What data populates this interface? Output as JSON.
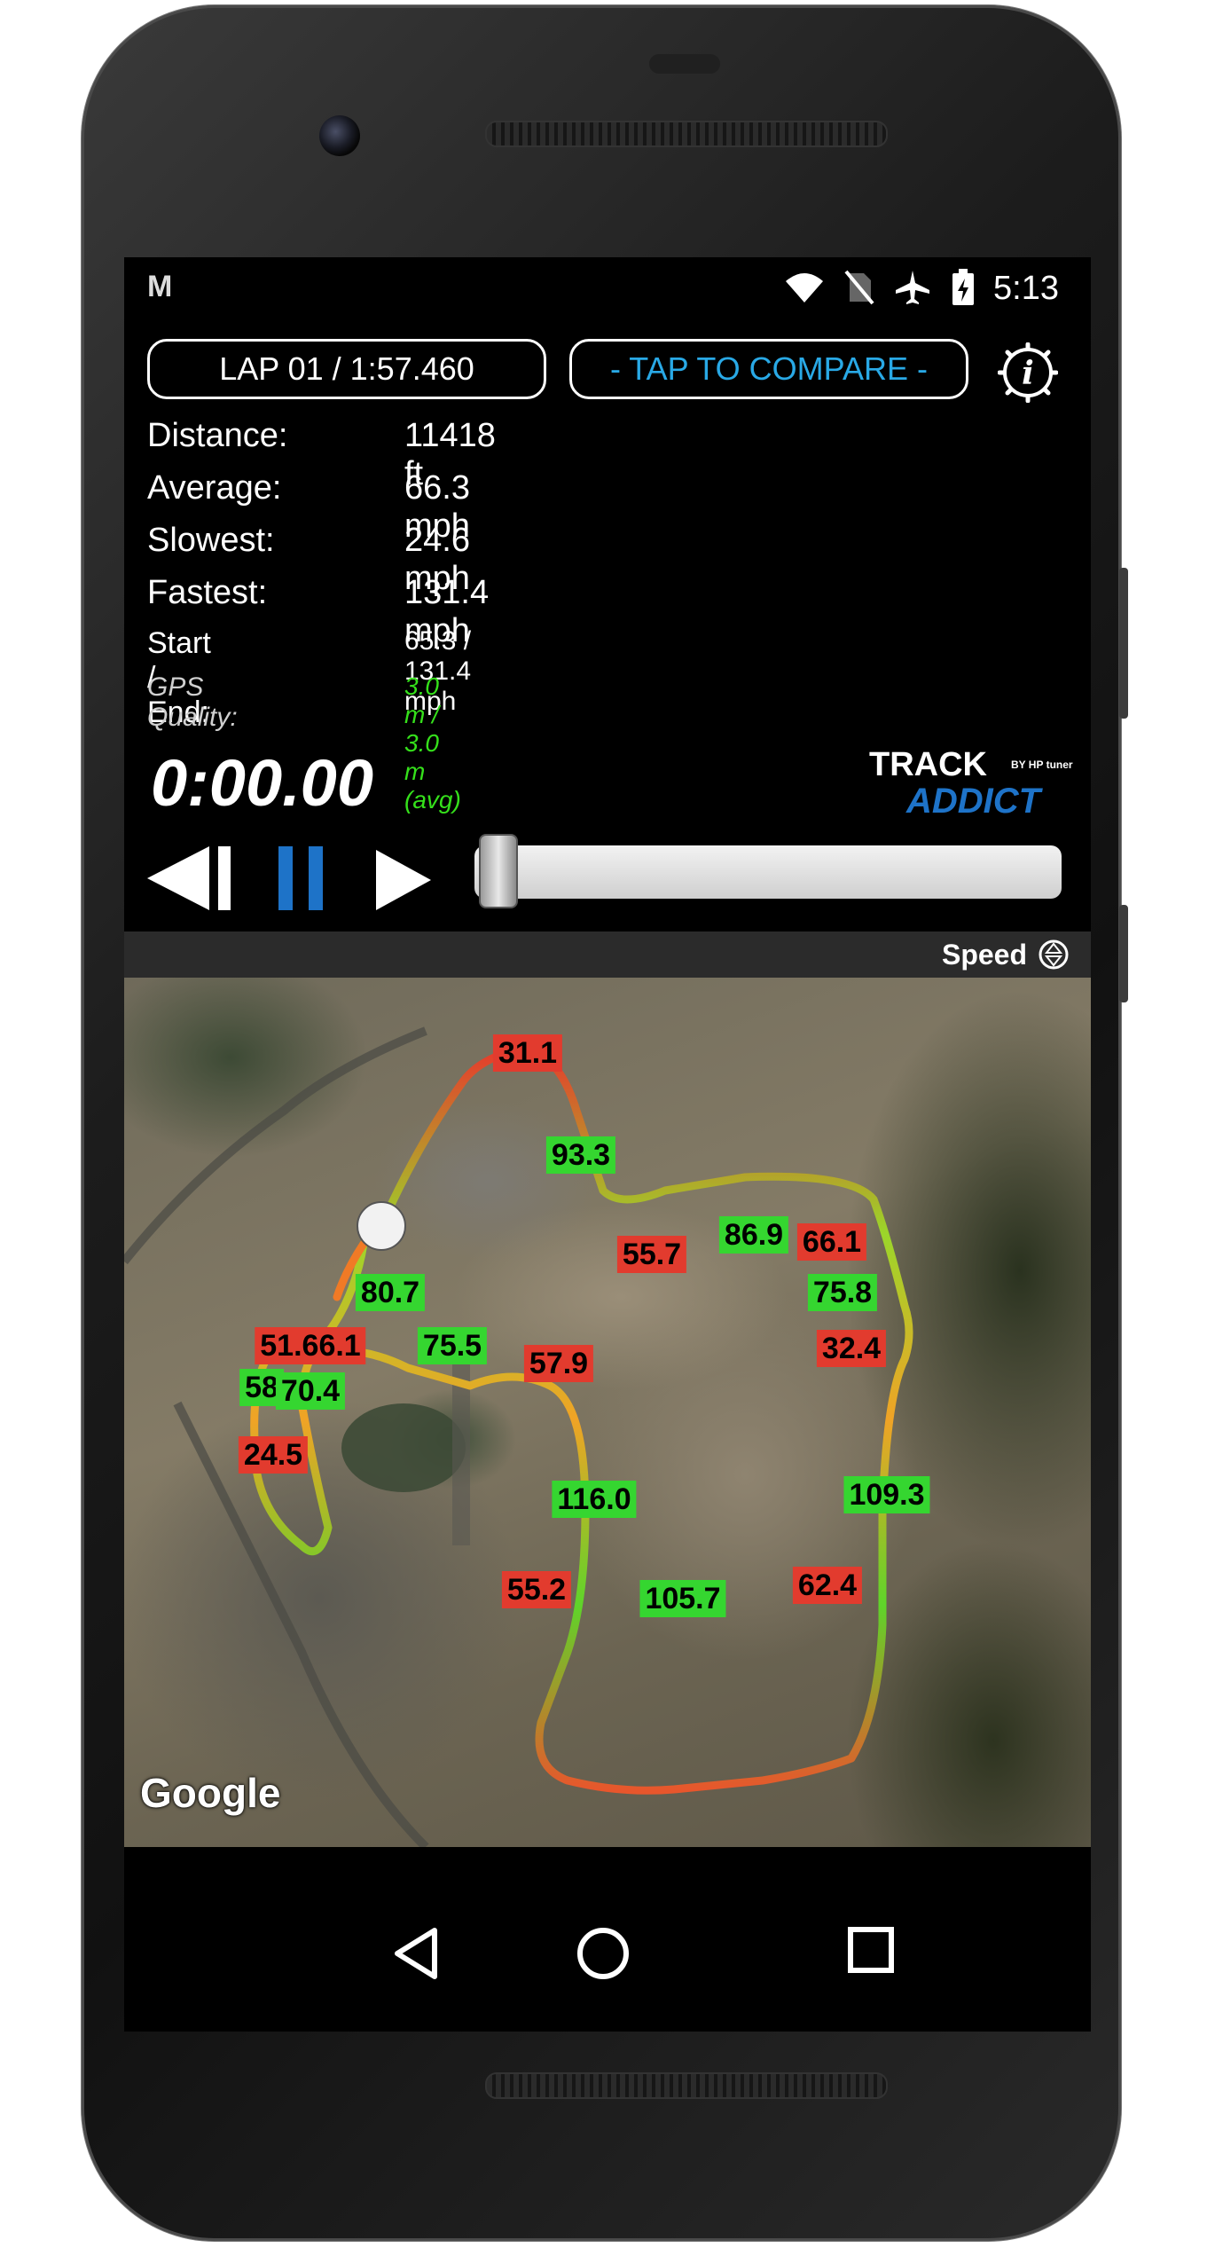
{
  "status_bar": {
    "notification_icon": "gmail-icon",
    "notification_glyph": "M",
    "time": "5:13",
    "icons": [
      "wifi-icon",
      "no-sim-icon",
      "airplane-icon",
      "battery-charging-icon"
    ]
  },
  "header": {
    "lap_label": "LAP 01 / 1:57.460",
    "compare_label": "- TAP TO COMPARE -",
    "info_icon": "info-icon"
  },
  "stats": {
    "distance_label": "Distance:",
    "distance_value": "11418 ft",
    "average_label": "Average:",
    "average_value": "66.3 mph",
    "slowest_label": "Slowest:",
    "slowest_value": "24.6 mph",
    "fastest_label": "Fastest:",
    "fastest_value": "131.4 mph",
    "start_end_label": "Start / End:",
    "start_end_value": "65.3 / 131.4 mph",
    "gps_label": "GPS Quality:",
    "gps_value": "3.0 m / 3.0 m (avg)"
  },
  "playback": {
    "timer": "0:00.00",
    "progress": 0
  },
  "logo": {
    "line1": "TRACK",
    "line2": "ADDICT",
    "byline": "BY HP tuners"
  },
  "map": {
    "overlay_label": "Speed",
    "attribution": "Google",
    "speed_labels": [
      {
        "text": "31.1",
        "level": "red"
      },
      {
        "text": "93.3",
        "level": "green"
      },
      {
        "text": "55.7",
        "level": "red"
      },
      {
        "text": "86.9",
        "level": "green"
      },
      {
        "text": "66.1",
        "level": "red"
      },
      {
        "text": "80.7",
        "level": "green"
      },
      {
        "text": "75.8",
        "level": "green"
      },
      {
        "text": "51.66.1",
        "level": "red"
      },
      {
        "text": "75.5",
        "level": "green"
      },
      {
        "text": "57.9",
        "level": "red"
      },
      {
        "text": "32.4",
        "level": "red"
      },
      {
        "text": "58",
        "level": "green"
      },
      {
        "text": "70.4",
        "level": "green"
      },
      {
        "text": "24.5",
        "level": "red"
      },
      {
        "text": "116.0",
        "level": "green"
      },
      {
        "text": "109.3",
        "level": "green"
      },
      {
        "text": "55.2",
        "level": "red"
      },
      {
        "text": "105.7",
        "level": "green"
      },
      {
        "text": "62.4",
        "level": "red"
      }
    ]
  },
  "nav": {
    "back_icon": "back-icon",
    "home_icon": "home-icon",
    "recents_icon": "recents-icon"
  },
  "colors": {
    "accent_blue": "#29a9e6",
    "gps_green": "#35e01b",
    "slow": "#e23b2e",
    "fast": "#35d630"
  }
}
